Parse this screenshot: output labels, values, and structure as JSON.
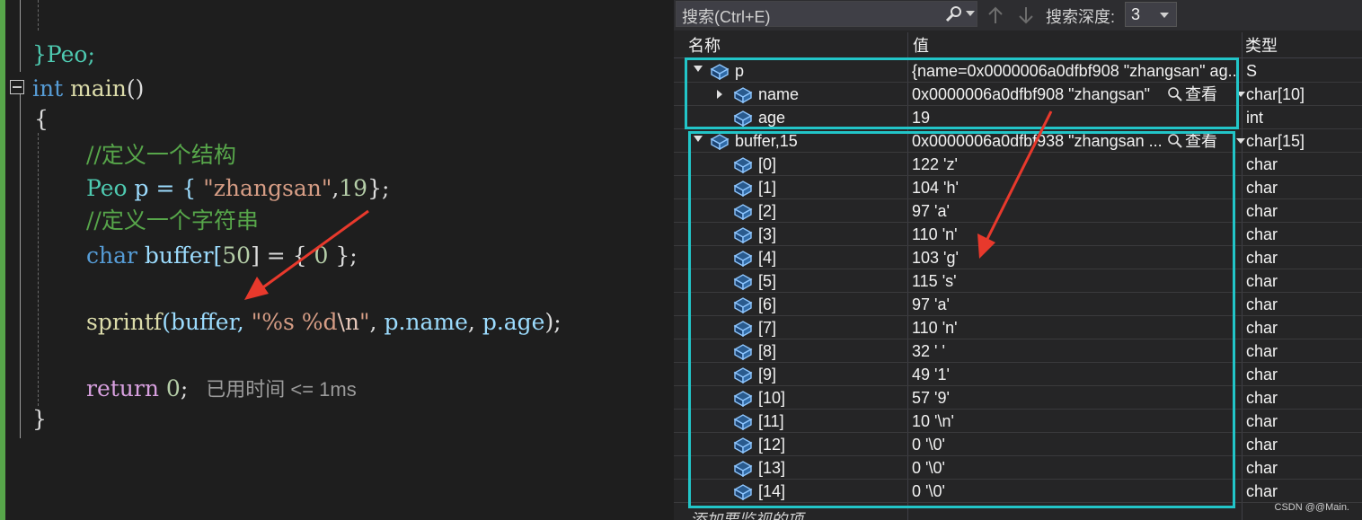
{
  "editor": {
    "closing_struct": "}Peo;",
    "main_sig_kw": "int",
    "main_sig_name": " main",
    "main_sig_rest": "()",
    "open_brace": "{",
    "comment1": "//定义一个结构",
    "peo_type": "Peo",
    "peo_var": " p = { ",
    "peo_str": "\"zhangsan\"",
    "peo_comma": ",",
    "peo_num": "19",
    "peo_end": "};",
    "comment2": "//定义一个字符串",
    "char_kw": "char",
    "buffer_decl": " buffer[",
    "buffer_size": "50",
    "buffer_rest": "] = { ",
    "buffer_zero": "0",
    "buffer_end": " };",
    "sprintf_fn": "sprintf",
    "sprintf_open": "(buffer, ",
    "sprintf_fmt_a": "\"%s %d",
    "sprintf_fmt_esc": "\\n",
    "sprintf_fmt_b": "\"",
    "sprintf_sep1": ", ",
    "sprintf_arg1_obj": "p.",
    "sprintf_arg1_mem": "name",
    "sprintf_sep2": ", ",
    "sprintf_arg2_obj": "p.",
    "sprintf_arg2_mem": "age",
    "sprintf_end": ");",
    "return_kw": "return",
    "return_val": " 0",
    "return_end": ";",
    "perf_tip": "已用时间 <= 1ms",
    "close_brace": "}"
  },
  "watch": {
    "search_placeholder": "搜索(Ctrl+E)",
    "search_depth_label": "搜索深度:",
    "search_depth_value": "3",
    "columns": {
      "name": "名称",
      "value": "值",
      "type": "类型"
    },
    "view_label": "查看",
    "rows": [
      {
        "name": "p",
        "value": "{name=0x0000006a0dfbf908 \"zhangsan\" ag...",
        "type": "S",
        "expander": "open",
        "indent": 0,
        "view": false
      },
      {
        "name": "name",
        "value": "0x0000006a0dfbf908 \"zhangsan\"",
        "type": "char[10]",
        "expander": "closed",
        "indent": 1,
        "view": true
      },
      {
        "name": "age",
        "value": "19",
        "type": "int",
        "expander": "none",
        "indent": 1,
        "view": false
      },
      {
        "name": "buffer,15",
        "value": "0x0000006a0dfbf938 \"zhangsan ...",
        "type": "char[15]",
        "expander": "open",
        "indent": 0,
        "view": true
      },
      {
        "name": "[0]",
        "value": "122 'z'",
        "type": "char",
        "expander": "none",
        "indent": 1,
        "view": false
      },
      {
        "name": "[1]",
        "value": "104 'h'",
        "type": "char",
        "expander": "none",
        "indent": 1,
        "view": false
      },
      {
        "name": "[2]",
        "value": "97 'a'",
        "type": "char",
        "expander": "none",
        "indent": 1,
        "view": false
      },
      {
        "name": "[3]",
        "value": "110 'n'",
        "type": "char",
        "expander": "none",
        "indent": 1,
        "view": false
      },
      {
        "name": "[4]",
        "value": "103 'g'",
        "type": "char",
        "expander": "none",
        "indent": 1,
        "view": false
      },
      {
        "name": "[5]",
        "value": "115 's'",
        "type": "char",
        "expander": "none",
        "indent": 1,
        "view": false
      },
      {
        "name": "[6]",
        "value": "97 'a'",
        "type": "char",
        "expander": "none",
        "indent": 1,
        "view": false
      },
      {
        "name": "[7]",
        "value": "110 'n'",
        "type": "char",
        "expander": "none",
        "indent": 1,
        "view": false
      },
      {
        "name": "[8]",
        "value": "32 ' '",
        "type": "char",
        "expander": "none",
        "indent": 1,
        "view": false
      },
      {
        "name": "[9]",
        "value": "49 '1'",
        "type": "char",
        "expander": "none",
        "indent": 1,
        "view": false
      },
      {
        "name": "[10]",
        "value": "57 '9'",
        "type": "char",
        "expander": "none",
        "indent": 1,
        "view": false
      },
      {
        "name": "[11]",
        "value": "10 '\\n'",
        "type": "char",
        "expander": "none",
        "indent": 1,
        "view": false
      },
      {
        "name": "[12]",
        "value": "0 '\\0'",
        "type": "char",
        "expander": "none",
        "indent": 1,
        "view": false
      },
      {
        "name": "[13]",
        "value": "0 '\\0'",
        "type": "char",
        "expander": "none",
        "indent": 1,
        "view": false
      },
      {
        "name": "[14]",
        "value": "0 '\\0'",
        "type": "char",
        "expander": "none",
        "indent": 1,
        "view": false
      }
    ],
    "add_watch_label": "添加要监视的项"
  },
  "watermark": "CSDN @@Main.",
  "colors": {
    "highlight_box": "#22c5c8",
    "annotation_arrow": "#e8392c",
    "debug_margin": "#57a64a"
  }
}
